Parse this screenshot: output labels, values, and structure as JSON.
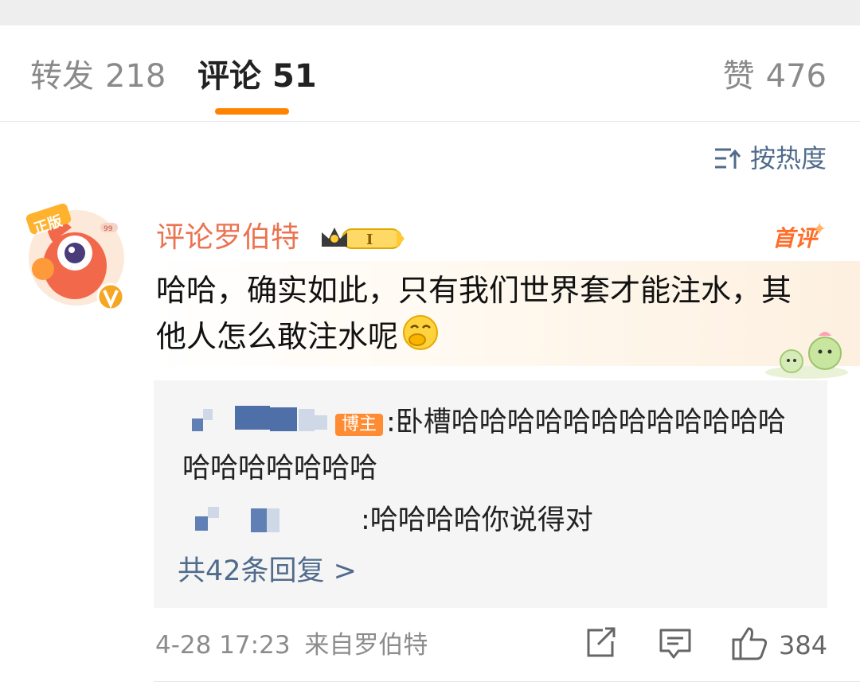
{
  "tabs": {
    "repost": {
      "label": "转发",
      "count": "218"
    },
    "comment": {
      "label": "评论",
      "count": "51"
    },
    "like": {
      "label": "赞",
      "count": "476"
    }
  },
  "sort": {
    "label": "按热度"
  },
  "comment": {
    "username": "评论罗伯特",
    "level_badge": "I",
    "tag": "首评",
    "avatar_badge": "正版",
    "text": "哈哈，确实如此，只有我们世界套才能注水，其他人怎么敢注水呢",
    "time": "4-28 17:23",
    "source": "来自罗伯特",
    "like_count": "384"
  },
  "replies": [
    {
      "author_tag": "博主",
      "text": ":卧槽哈哈哈哈哈哈哈哈哈哈哈哈哈哈哈哈哈哈哈"
    },
    {
      "text": ":哈哈哈哈你说得对"
    }
  ],
  "replies_more": "共42条回复 >",
  "colors": {
    "accent": "#ff8200",
    "username": "#eb7350",
    "link": "#506b8c"
  }
}
